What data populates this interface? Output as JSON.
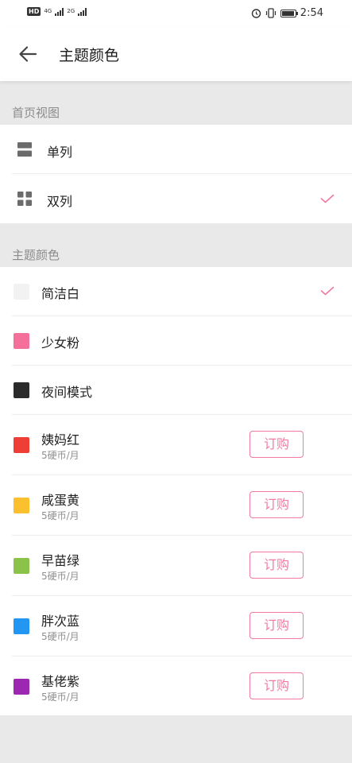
{
  "status_bar": {
    "hd": "HD",
    "sim1_type": "4G",
    "sim2_type": "2G",
    "time": "2:54"
  },
  "header": {
    "back_icon": "arrow-left-icon",
    "title": "主题颜色"
  },
  "home_view": {
    "section_title": "首页视图",
    "options": [
      {
        "label": "单列",
        "icon": "single-column-icon",
        "selected": false
      },
      {
        "label": "双列",
        "icon": "grid-icon",
        "selected": true
      }
    ]
  },
  "theme_colors": {
    "section_title": "主题颜色",
    "accent_color": "#f07aa0",
    "items": [
      {
        "label": "简洁白",
        "color": "#f2f2f2",
        "selected": true
      },
      {
        "label": "少女粉",
        "color": "#f4709a",
        "selected": false
      },
      {
        "label": "夜间模式",
        "color": "#2b2b2b",
        "selected": false
      },
      {
        "label": "姨妈红",
        "color": "#ef3e36",
        "price": "5硬币/月",
        "button": "订购"
      },
      {
        "label": "咸蛋黄",
        "color": "#fbc02d",
        "price": "5硬币/月",
        "button": "订购"
      },
      {
        "label": "早苗绿",
        "color": "#8bc34a",
        "price": "5硬币/月",
        "button": "订购"
      },
      {
        "label": "胖次蓝",
        "color": "#2196f3",
        "price": "5硬币/月",
        "button": "订购"
      },
      {
        "label": "基佬紫",
        "color": "#9c27b0",
        "price": "5硬币/月",
        "button": "订购"
      }
    ]
  }
}
